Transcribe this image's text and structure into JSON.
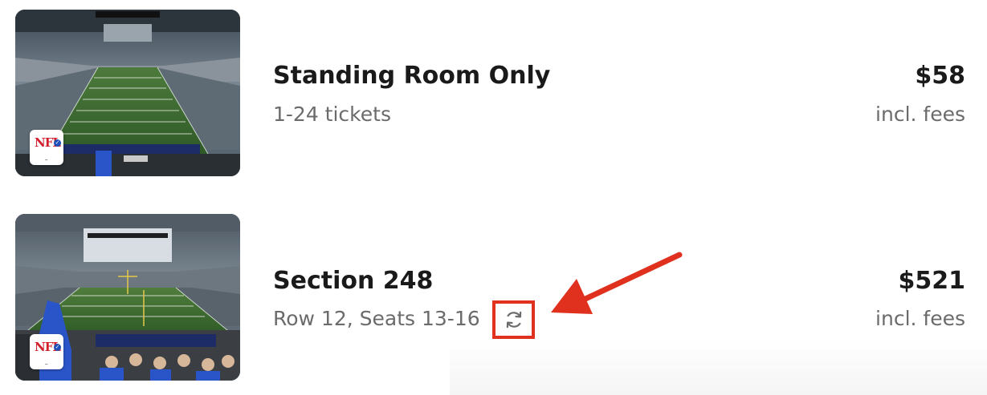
{
  "listings": [
    {
      "title": "Standing Room Only",
      "subtitle": "1-24 tickets",
      "price": "$58",
      "price_note": "incl. fees",
      "badge": {
        "logo_text": "NFL",
        "icon": "nfl-verified-ticket-badge"
      },
      "image": "stadium-view-image"
    },
    {
      "title": "Section 248",
      "subtitle": "Row 12, Seats 13-16",
      "price": "$521",
      "price_note": "incl. fees",
      "badge": {
        "logo_text": "NFL",
        "icon": "nfl-verified-ticket-badge"
      },
      "image": "stadium-view-image",
      "extra_icon": "refresh-icon"
    }
  ],
  "annotation": {
    "highlight_color": "#e0311f",
    "arrow_icon": "red-arrow-pointer"
  }
}
